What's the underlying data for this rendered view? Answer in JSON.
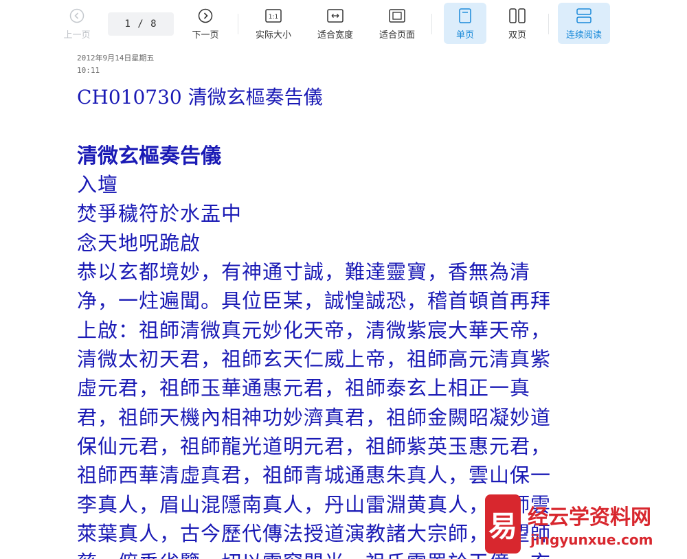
{
  "toolbar": {
    "prev_label": "上一页",
    "page_indicator": "1 / 8",
    "next_label": "下一页",
    "actual_size_label": "实际大小",
    "actual_size_icon_text": "1:1",
    "fit_width_label": "适合宽度",
    "fit_page_label": "适合页面",
    "single_page_label": "单页",
    "double_page_label": "双页",
    "continuous_label": "连续阅读",
    "accent_color": "#1a8ad9",
    "active_bg": "#dcedfb"
  },
  "document": {
    "date_line": "2012年9月14日星期五",
    "time_line": "10:11",
    "code_title": "CH010730 清微玄樞奏告儀",
    "heading": "清微玄樞奏告儀",
    "text_color": "#1a1ab5",
    "lines": [
      "入壇",
      "焚爭穢符於水盂中",
      "念天地呪跪啟",
      "恭以玄都境妙，有神通寸誠，難達靈寶，香無為清",
      "净，一炷遍聞。具位臣某，誠惶誠恐，稽首頓首再拜",
      "上啟：祖師清微真元妙化天帝，清微紫宸大華天帝，",
      "清微太初天君，祖師玄天仁威上帝，祖師高元清真紫",
      "虛元君，祖師玉華通惠元君，祖師泰玄上相正一真",
      "君，祖師天機內相神功妙濟真君，祖師金闕昭凝妙道",
      "保仙元君，祖師龍光道明元君，祖師紫英玉惠元君，",
      "祖師西華清虛真君，祖師青城通惠朱真人，雲山保一",
      "李真人，眉山混隱南真人，丹山雷淵黄真人，宗師雲",
      "萊葉真人，古今歷代傳法授道演教諸大宗師，恭望師",
      "慈，俯垂省覽，切以雲窗閒光，祖氏雲罟於天億，玄"
    ]
  },
  "watermark": {
    "logo_char": "易",
    "site_name": "经云学资料网",
    "url": "jingyunxue.com",
    "color": "#d8272e"
  }
}
